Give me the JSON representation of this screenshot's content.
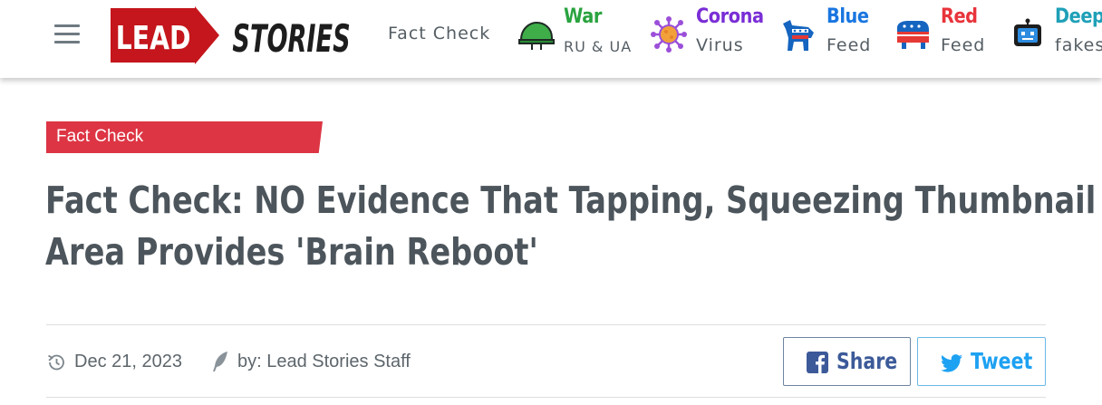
{
  "header": {
    "logo": {
      "left": "LEAD",
      "right": "STORIES"
    },
    "fact_check_link": "Fact Check",
    "nav": [
      {
        "id": "war",
        "title": "War",
        "subtitle": "RU & UA",
        "color": "#2aa33f",
        "icon": "helmet-icon"
      },
      {
        "id": "corona",
        "title": "Corona",
        "subtitle": "Virus",
        "color": "#7a2ed6",
        "icon": "virus-icon"
      },
      {
        "id": "blue",
        "title": "Blue",
        "subtitle": "Feed",
        "color": "#1976e0",
        "icon": "donkey-icon"
      },
      {
        "id": "red",
        "title": "Red",
        "subtitle": "Feed",
        "color": "#e8343b",
        "icon": "elephant-icon"
      },
      {
        "id": "deep",
        "title": "Deep",
        "subtitle": "fakes",
        "color": "#1fa0b8",
        "icon": "robot-icon"
      }
    ]
  },
  "article": {
    "category": "Fact Check",
    "headline_line1": "Fact Check: NO Evidence That Tapping, Squeezing Thumbnail",
    "headline_line2": "Area Provides 'Brain Reboot'",
    "date": "Dec 21, 2023",
    "author": "by: Lead Stories Staff",
    "share_label": "Share",
    "tweet_label": "Tweet"
  },
  "colors": {
    "logo_red": "#c4161c",
    "badge_red": "#dd3544",
    "facebook_blue": "#3c5a99",
    "twitter_blue": "#1da1f2",
    "text_dark": "#4c555b"
  }
}
